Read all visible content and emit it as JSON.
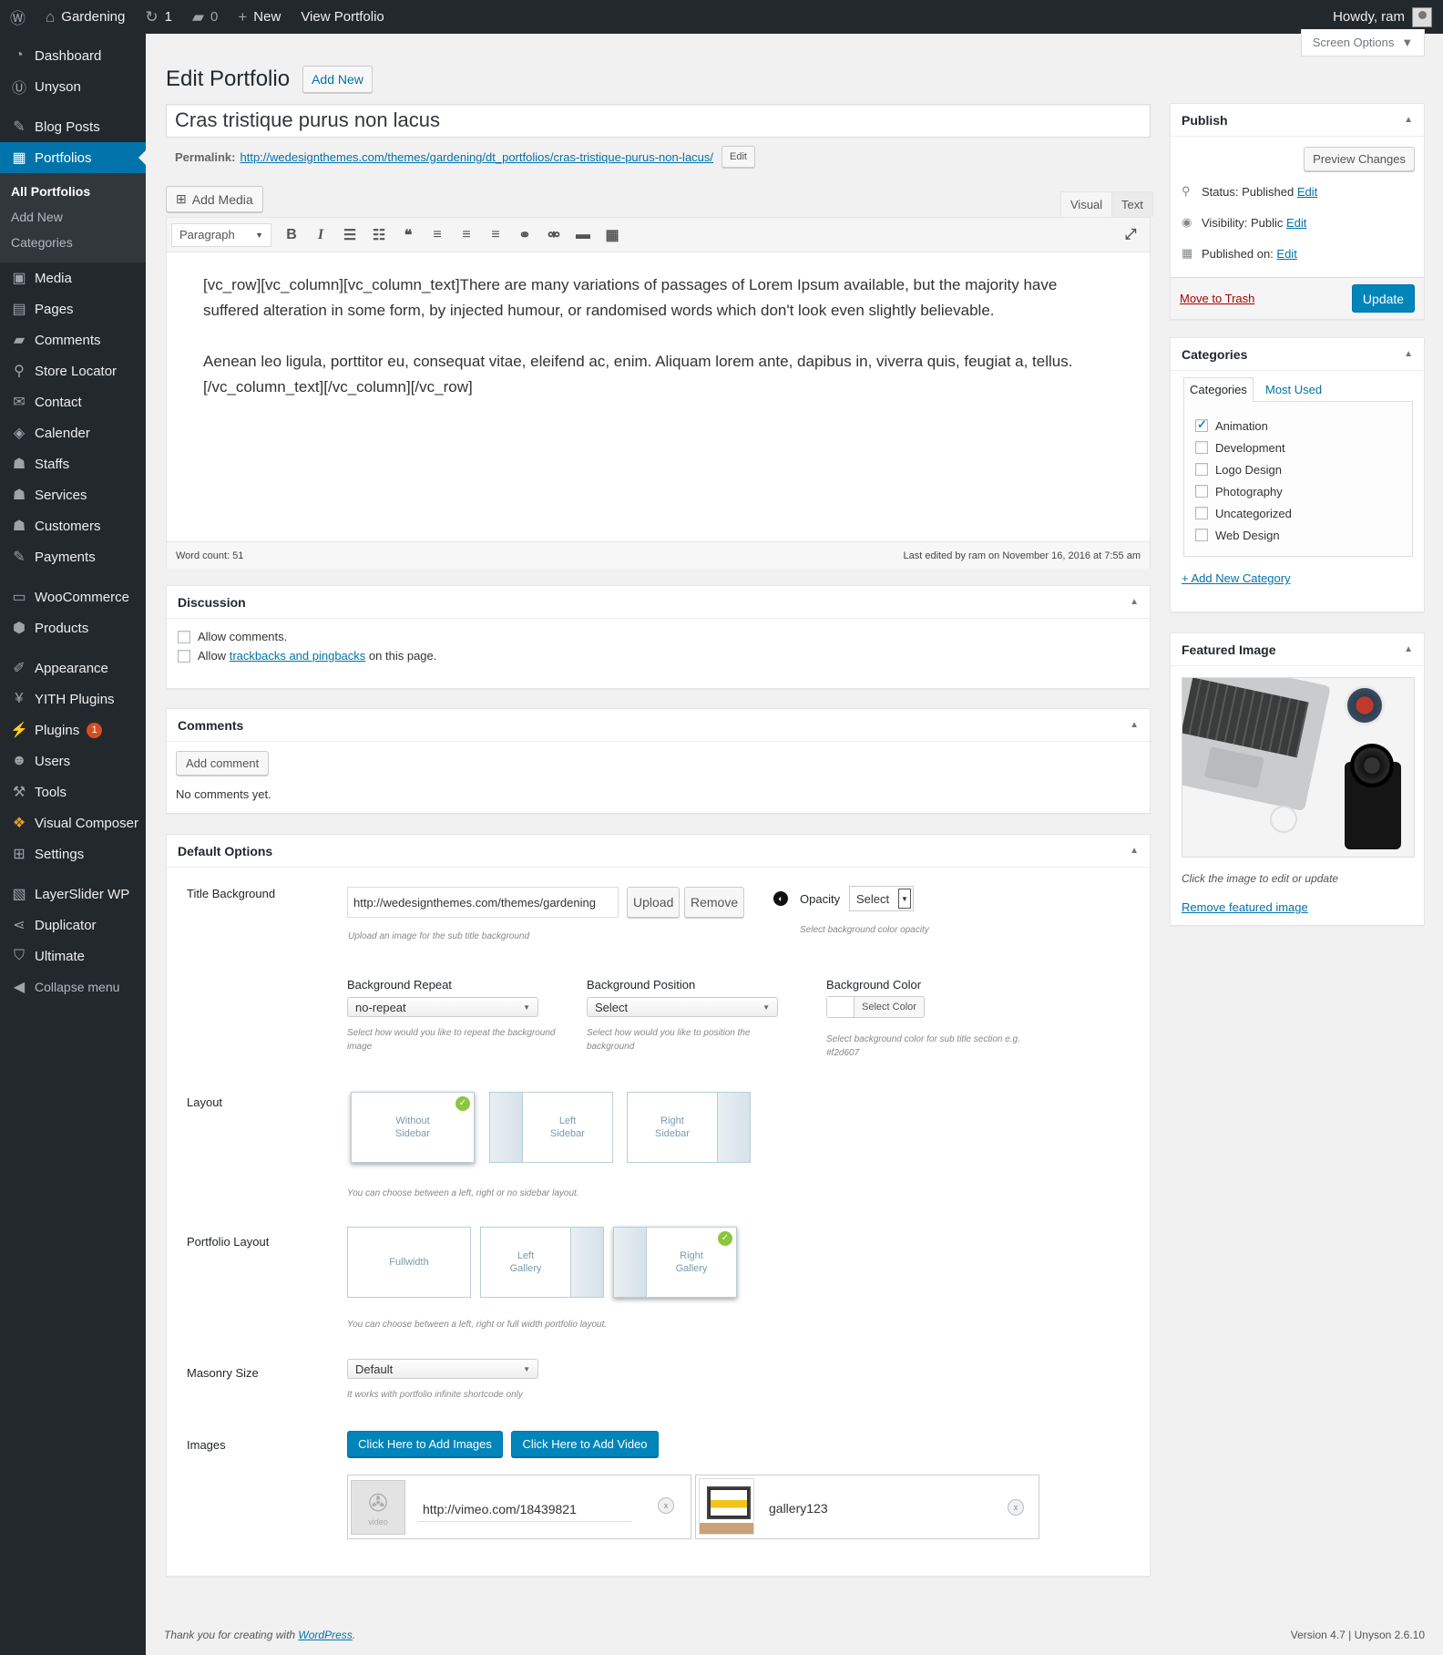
{
  "adminbar": {
    "site_name": "Gardening",
    "updates_count": "1",
    "comments_count": "0",
    "new_label": "New",
    "view_label": "View Portfolio",
    "greeting": "Howdy, ram"
  },
  "sidebar": {
    "items": [
      {
        "label": "Dashboard",
        "icon": "dashboard-icon"
      },
      {
        "label": "Unyson",
        "icon": "unyson-icon"
      },
      {
        "label": "Blog Posts",
        "icon": "pin-icon"
      },
      {
        "label": "Portfolios",
        "icon": "portfolio-icon"
      },
      {
        "label": "Media",
        "icon": "media-icon"
      },
      {
        "label": "Pages",
        "icon": "pages-icon"
      },
      {
        "label": "Comments",
        "icon": "comments-icon"
      },
      {
        "label": "Store Locator",
        "icon": "location-icon"
      },
      {
        "label": "Contact",
        "icon": "email-icon"
      },
      {
        "label": "Calender",
        "icon": "tag-icon"
      },
      {
        "label": "Staffs",
        "icon": "groups-icon"
      },
      {
        "label": "Services",
        "icon": "services-icon"
      },
      {
        "label": "Customers",
        "icon": "customers-icon"
      },
      {
        "label": "Payments",
        "icon": "payments-icon"
      },
      {
        "label": "WooCommerce",
        "icon": "woo-icon"
      },
      {
        "label": "Products",
        "icon": "products-icon"
      },
      {
        "label": "Appearance",
        "icon": "brush-icon"
      },
      {
        "label": "YITH Plugins",
        "icon": "yith-icon"
      },
      {
        "label": "Plugins",
        "icon": "plugin-icon",
        "badge": "1"
      },
      {
        "label": "Users",
        "icon": "users-icon"
      },
      {
        "label": "Tools",
        "icon": "tools-icon"
      },
      {
        "label": "Visual Composer",
        "icon": "vc-icon"
      },
      {
        "label": "Settings",
        "icon": "settings-icon"
      },
      {
        "label": "LayerSlider WP",
        "icon": "layers-icon"
      },
      {
        "label": "Duplicator",
        "icon": "share-icon"
      },
      {
        "label": "Ultimate",
        "icon": "shield-icon"
      },
      {
        "label": "Collapse menu",
        "icon": "collapse-icon"
      }
    ],
    "submenu": [
      "All Portfolios",
      "Add New",
      "Categories"
    ]
  },
  "screen_options": "Screen Options",
  "page": {
    "title": "Edit Portfolio",
    "add_new": "Add New",
    "post_title": "Cras tristique purus non lacus",
    "permalink_label": "Permalink:",
    "permalink_url": "http://wedesignthemes.com/themes/gardening/dt_portfolios/cras-tristique-purus-non-lacus/",
    "edit_label": "Edit"
  },
  "editor": {
    "add_media": "Add Media",
    "tab_visual": "Visual",
    "tab_text": "Text",
    "format": "Paragraph",
    "para1": "[vc_row][vc_column][vc_column_text]There are many variations of passages of Lorem Ipsum available, but the majority have suffered alteration in some form, by injected humour, or randomised words which don't look even slightly believable.",
    "para2": "Aenean leo ligula, porttitor eu, consequat vitae, eleifend ac, enim. Aliquam lorem ante, dapibus in, viverra quis, feugiat a, tellus.[/vc_column_text][/vc_column][/vc_row]",
    "word_count": "Word count: 51",
    "last_edited": "Last edited by ram on November 16, 2016 at 7:55 am"
  },
  "discussion": {
    "title": "Discussion",
    "allow_comments": "Allow comments.",
    "allow_prefix": "Allow",
    "trackbacks_link": "trackbacks and pingbacks",
    "allow_suffix": "on this page."
  },
  "comments_box": {
    "title": "Comments",
    "add_button": "Add comment",
    "empty": "No comments yet."
  },
  "options": {
    "title": "Default Options",
    "title_bg_label": "Title Background",
    "title_bg_value": "http://wedesignthemes.com/themes/gardening",
    "upload": "Upload",
    "remove": "Remove",
    "upload_desc": "Upload an image for the sub title background",
    "opacity_label": "Opacity",
    "opacity_value": "Select",
    "opacity_desc": "Select background color opacity",
    "bg_repeat_label": "Background Repeat",
    "bg_repeat_value": "no-repeat",
    "bg_repeat_desc": "Select how would you like to repeat the background image",
    "bg_position_label": "Background Position",
    "bg_position_value": "Select",
    "bg_position_desc": "Select how would you like to position the background",
    "bg_color_label": "Background Color",
    "bg_color_btn": "Select Color",
    "bg_color_desc": "Select background color for sub title section e.g. #f2d607",
    "layout_label": "Layout",
    "layout_without": "Without Sidebar",
    "layout_left": "Left Sidebar",
    "layout_right": "Right Sidebar",
    "layout_desc": "You can choose between a left, right or no sidebar layout.",
    "portfolio_layout_label": "Portfolio Layout",
    "pl_full": "Fullwidth",
    "pl_left": "Left Gallery",
    "pl_right": "Right Gallery",
    "pl_desc": "You can choose between a left, right or full width portfolio layout.",
    "masonry_label": "Masonry Size",
    "masonry_value": "Default",
    "masonry_desc": "It works with portfolio infinite shortcode only",
    "images_label": "Images",
    "add_images": "Click Here to Add Images",
    "add_video": "Click Here to Add Video",
    "video_url": "http://vimeo.com/18439821",
    "video_caption": "video",
    "gallery_name": "gallery123",
    "remove_x": "x"
  },
  "publish": {
    "title": "Publish",
    "preview": "Preview Changes",
    "status_label": "Status:",
    "status_value": "Published",
    "visibility_label": "Visibility:",
    "visibility_value": "Public",
    "published_label": "Published on:",
    "edit": "Edit",
    "trash": "Move to Trash",
    "update": "Update"
  },
  "categories": {
    "title": "Categories",
    "tab_all": "Categories",
    "tab_used": "Most Used",
    "items": [
      {
        "label": "Animation",
        "checked": true
      },
      {
        "label": "Development",
        "checked": false
      },
      {
        "label": "Logo Design",
        "checked": false
      },
      {
        "label": "Photography",
        "checked": false
      },
      {
        "label": "Uncategorized",
        "checked": false
      },
      {
        "label": "Web Design",
        "checked": false
      }
    ],
    "add_new": "+ Add New Category"
  },
  "featured": {
    "title": "Featured Image",
    "hint": "Click the image to edit or update",
    "remove": "Remove featured image"
  },
  "footer": {
    "thanks_prefix": "Thank you for creating with",
    "thanks_link": "WordPress",
    "thanks_suffix": ".",
    "version": "Version 4.7 | Unyson 2.6.10"
  },
  "colors": {
    "accent": "#0073aa",
    "sidebar_bg": "#23282d",
    "update_button": "#0085ba",
    "trash": "#a00",
    "check_green": "#8cc63f"
  }
}
